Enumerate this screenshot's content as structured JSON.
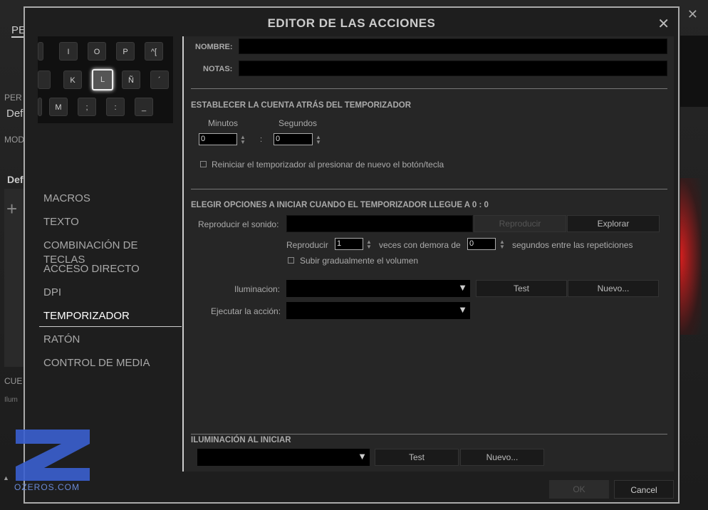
{
  "background": {
    "tab_partial": "PE",
    "profile_label": "PER",
    "profile_value": "Def",
    "mode_label": "MOD",
    "mode_value": "Def",
    "add_symbol": "+",
    "cue_label": "CUE",
    "cue_value": "Ilum",
    "close_symbol": "✕",
    "up_arrow": "▲"
  },
  "dialog": {
    "title": "EDITOR DE LAS ACCIONES",
    "close_symbol": "✕"
  },
  "keyboard": {
    "row1": [
      "I",
      "O",
      "P",
      "^["
    ],
    "row2": [
      "K",
      "L",
      "Ñ",
      "´"
    ],
    "row3": [
      "M",
      ";",
      ":",
      "_"
    ],
    "selected_key": "L"
  },
  "nav": {
    "items": [
      "MACROS",
      "TEXTO",
      "COMBINACIÓN DE TECLAS",
      "ACCESO DIRECTO",
      "DPI",
      "TEMPORIZADOR",
      "RATÓN",
      "CONTROL DE MEDIA"
    ],
    "active": "TEMPORIZADOR"
  },
  "form": {
    "name_label": "NOMBRE:",
    "name_value": "",
    "notes_label": "NOTAS:",
    "notes_value": "",
    "timer_section": "ESTABLECER LA CUENTA ATRÁS DEL TEMPORIZADOR",
    "minutes_label": "Minutos",
    "seconds_label": "Segundos",
    "minutes_value": "0",
    "seconds_value": "0",
    "separator": ":",
    "restart_checkbox": "Reiniciar el temporizador al presionar de nuevo el botón/tecla",
    "restart_checked": false,
    "options_section": "ELEGIR OPCIONES A INICIAR CUANDO EL TEMPORIZADOR LLEGUE A 0 : 0",
    "sound_label": "Reproducir el sonido:",
    "sound_value": "",
    "play_button": "Reproducir",
    "browse_button": "Explorar",
    "repeat_prefix": "Reproducir",
    "repeat_value": "1",
    "repeat_mid": "veces con demora de",
    "delay_value": "0",
    "repeat_suffix": "segundos entre las repeticiones",
    "fade_checkbox": "Subir gradualmente el volumen",
    "fade_checked": false,
    "lighting_label": "Iluminacion:",
    "test_button": "Test",
    "new_button": "Nuevo...",
    "execute_label": "Ejecutar la acción:",
    "start_lighting_section": "ILUMINACIÓN AL INICIAR",
    "start_test_button": "Test",
    "start_new_button": "Nuevo..."
  },
  "footer": {
    "ok_button": "OK",
    "cancel_button": "Cancel"
  },
  "watermark": {
    "text": "OZEROS.COM",
    "color": "#3a5fcf"
  }
}
